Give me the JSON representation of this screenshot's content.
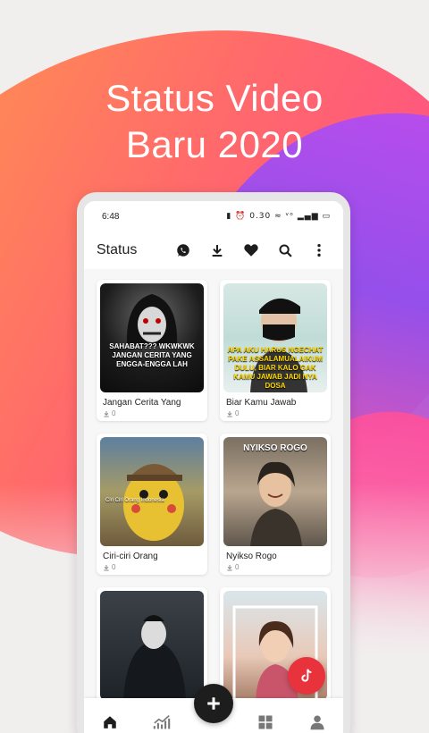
{
  "promo": {
    "line1": "Status Video",
    "line2": "Baru 2020"
  },
  "statusbar": {
    "time": "6:48",
    "icons": "▮ ⏰ 0.30 ≈ ᵛᵒ ▂▄▆ ▭"
  },
  "appbar": {
    "title": "Status",
    "actions": [
      "whatsapp-icon",
      "download-icon",
      "heart-icon",
      "search-icon",
      "more-vert-icon"
    ]
  },
  "cards": [
    {
      "title": "Jangan Cerita Yang",
      "downloads": "0",
      "overlay": "SAHABAT??? WKWKWK JANGAN CERITA YANG ENGGA-ENGGA LAH"
    },
    {
      "title": "Biar Kamu Jawab",
      "downloads": "0",
      "overlay": "APA AKU HARUS NGECHAT PAKE ASSALAMUALAIKUM DULU, BIAR KALO GAK KAMU JAWAB JADI NYA DOSA"
    },
    {
      "title": "Ciri-ciri Orang",
      "downloads": "0",
      "overlay": "Ciri Ciri Orang Indonesia"
    },
    {
      "title": "Nyikso Rogo",
      "downloads": "0",
      "overlay": "NYIKSO ROGO"
    },
    {
      "title": "",
      "downloads": "",
      "overlay": ""
    },
    {
      "title": "",
      "downloads": "",
      "overlay": ""
    }
  ],
  "bottom_nav": [
    "home-icon",
    "trending-icon",
    "add-icon",
    "categories-icon",
    "profile-icon"
  ],
  "colors": {
    "accent": "#1d1d1d",
    "tiktok": "#e8323c"
  }
}
